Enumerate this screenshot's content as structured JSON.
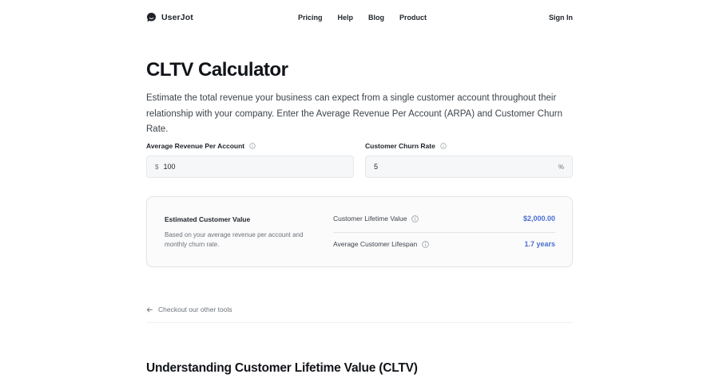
{
  "header": {
    "brand_name": "UserJot",
    "nav": [
      "Pricing",
      "Help",
      "Blog",
      "Product"
    ],
    "sign_in": "Sign In"
  },
  "main": {
    "title": "CLTV Calculator",
    "description": "Estimate the total revenue your business can expect from a single customer account throughout their relationship with your company. Enter the Average Revenue Per Account (ARPA) and Customer Churn Rate."
  },
  "inputs": {
    "arpa": {
      "label": "Average Revenue Per Account",
      "prefix": "$",
      "value": "100"
    },
    "churn": {
      "label": "Customer Churn Rate",
      "value": "5",
      "suffix": "%"
    }
  },
  "result": {
    "title": "Estimated Customer Value",
    "subtitle": "Based on your average revenue per account and monthly churn rate.",
    "clv_label": "Customer Lifetime Value",
    "clv_value": "$2,000.00",
    "lifespan_label": "Average Customer Lifespan",
    "lifespan_value": "1.7 years"
  },
  "footer": {
    "back_link": "Checkout our other tools",
    "section_heading": "Understanding Customer Lifetime Value (CLTV)"
  },
  "colors": {
    "accent": "#4a6fd3",
    "text": "#1f2328",
    "muted": "#6b7178",
    "input_bg": "#f6f7f8"
  }
}
